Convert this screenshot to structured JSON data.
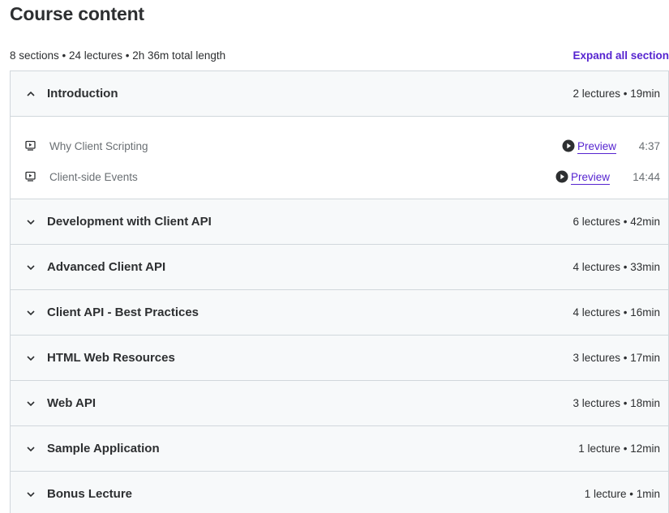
{
  "page": {
    "title": "Course content",
    "summary": "8 sections • 24 lectures • 2h 36m total length",
    "expand_all_label": "Expand all section"
  },
  "sections": [
    {
      "title": "Introduction",
      "meta": "2 lectures • 19min",
      "expanded": true,
      "lectures": [
        {
          "title": "Why Client Scripting",
          "preview": "Preview",
          "duration": "4:37"
        },
        {
          "title": "Client-side Events",
          "preview": "Preview",
          "duration": "14:44"
        }
      ]
    },
    {
      "title": "Development with Client API",
      "meta": "6 lectures • 42min",
      "expanded": false
    },
    {
      "title": "Advanced Client API",
      "meta": "4 lectures • 33min",
      "expanded": false
    },
    {
      "title": "Client API - Best Practices",
      "meta": "4 lectures • 16min",
      "expanded": false
    },
    {
      "title": "HTML Web Resources",
      "meta": "3 lectures • 17min",
      "expanded": false
    },
    {
      "title": "Web API",
      "meta": "3 lectures • 18min",
      "expanded": false
    },
    {
      "title": "Sample Application",
      "meta": "1 lecture • 12min",
      "expanded": false
    },
    {
      "title": "Bonus Lecture",
      "meta": "1 lecture • 1min",
      "expanded": false
    }
  ],
  "icons": {
    "chevron_up": "chevron-up-icon",
    "chevron_down": "chevron-down-icon",
    "video": "video-icon",
    "play": "play-circle-icon"
  },
  "colors": {
    "accent": "#5624d0",
    "header_bg": "#f7f9fa",
    "border": "#d1d7dc",
    "text": "#2d2f31",
    "muted": "#6a6f73"
  }
}
